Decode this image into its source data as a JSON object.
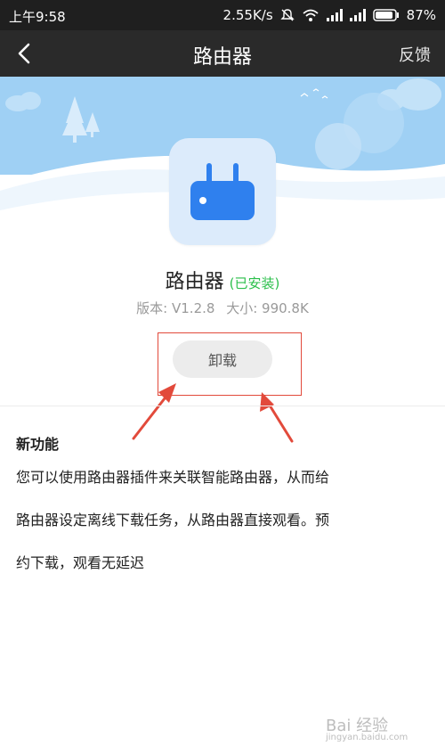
{
  "status_bar": {
    "time": "上午9:58",
    "speed": "2.55K/s",
    "battery": "87%"
  },
  "nav": {
    "title": "路由器",
    "feedback": "反馈",
    "back_icon": "chevron-left-icon"
  },
  "app": {
    "name": "路由器",
    "status": "(已安装)",
    "version": "版本: V1.2.8",
    "size": "大小: 990.8K",
    "icon": "router-icon"
  },
  "actions": {
    "uninstall": "卸载"
  },
  "colors": {
    "accent_green": "#2bbf4b",
    "highlight_red": "#e24a3b",
    "icon_blue": "#2f80ee",
    "sky_blue": "#9fd0f4"
  },
  "features": {
    "title": "新功能",
    "lines": [
      "您可以使用路由器插件来关联智能路由器，从而给",
      "路由器设定离线下载任务，从路由器直接观看。预",
      "约下载，观看无延迟"
    ]
  },
  "watermark": {
    "text": "Bai 经验",
    "sub": "jingyan.baidu.com"
  }
}
